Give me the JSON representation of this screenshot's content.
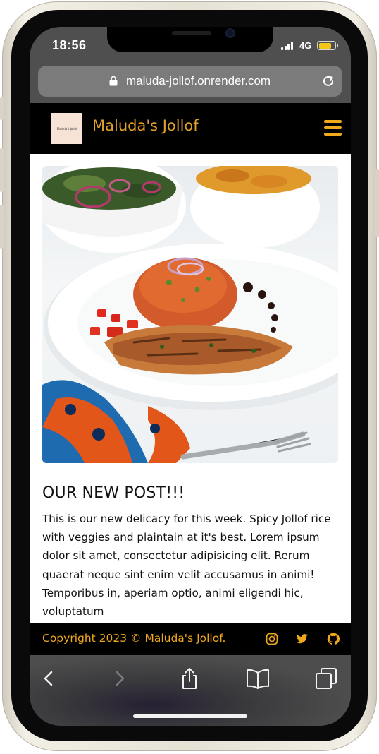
{
  "status_bar": {
    "time": "18:56",
    "network": "4G",
    "battery_level": 0.8
  },
  "browser": {
    "url": "maluda-jollof.onrender.com"
  },
  "site": {
    "logo_text": "Maluda's Jollof",
    "brand": "Maluda's Jollof",
    "accent_color": "#f0a81c"
  },
  "post": {
    "title": "OUR NEW POST!!!",
    "body": "This is our new delicacy for this week. Spicy Jollof rice with veggies and plaintain at it's best. Lorem ipsum dolor sit amet, consectetur adipisicing elit. Rerum quaerat neque sint enim velit accusamus in animi! Temporibus in, aperiam optio, animi eligendi hic, voluptatum"
  },
  "footer": {
    "copyright": "Copyright 2023 © Maluda's Jollof.",
    "social_icons": [
      "instagram-icon",
      "twitter-icon",
      "github-icon"
    ]
  },
  "toolbar": {
    "icons": [
      "back-icon",
      "forward-icon",
      "share-icon",
      "bookmarks-icon",
      "tabs-icon"
    ]
  }
}
